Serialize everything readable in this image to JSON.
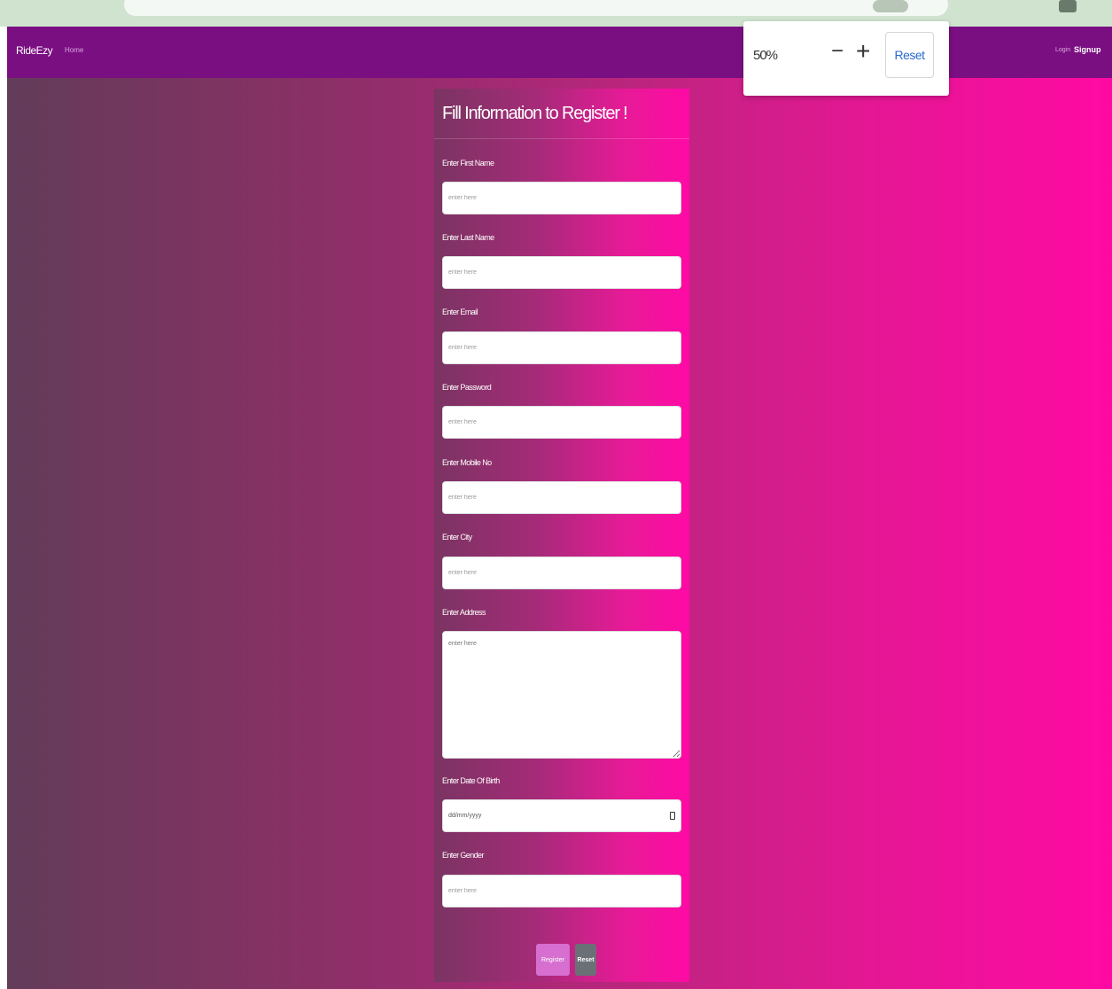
{
  "navbar": {
    "brand": "RideEzy",
    "home": "Home",
    "login": "Login",
    "signup": "Signup"
  },
  "zoom": {
    "level": "50%",
    "minus": "−",
    "plus": "+",
    "reset": "Reset"
  },
  "form": {
    "title": "Fill Information to Register !",
    "fields": [
      {
        "label": "Enter First Name",
        "placeholder": "enter here"
      },
      {
        "label": "Enter Last Name",
        "placeholder": "enter here"
      },
      {
        "label": "Enter Email",
        "placeholder": "enter here"
      },
      {
        "label": "Enter Password",
        "placeholder": "enter here"
      },
      {
        "label": "Enter Mobile No",
        "placeholder": "enter here"
      },
      {
        "label": "Enter City",
        "placeholder": "enter here"
      },
      {
        "label": "Enter Address",
        "placeholder": "enter here"
      },
      {
        "label": "Enter Date Of Birth",
        "placeholder": "dd/mm/yyyy"
      },
      {
        "label": "Enter Gender",
        "placeholder": "enter here"
      }
    ],
    "register_button": "Register",
    "reset_button": "Reset"
  },
  "colors": {
    "navbar": "#7a0f82",
    "gradient_left": "#623c59",
    "gradient_right": "#ff0aa3",
    "register_button": "#d66fd0",
    "reset_button": "#6b6f76",
    "zoom_reset_text": "#2a6ad0"
  }
}
